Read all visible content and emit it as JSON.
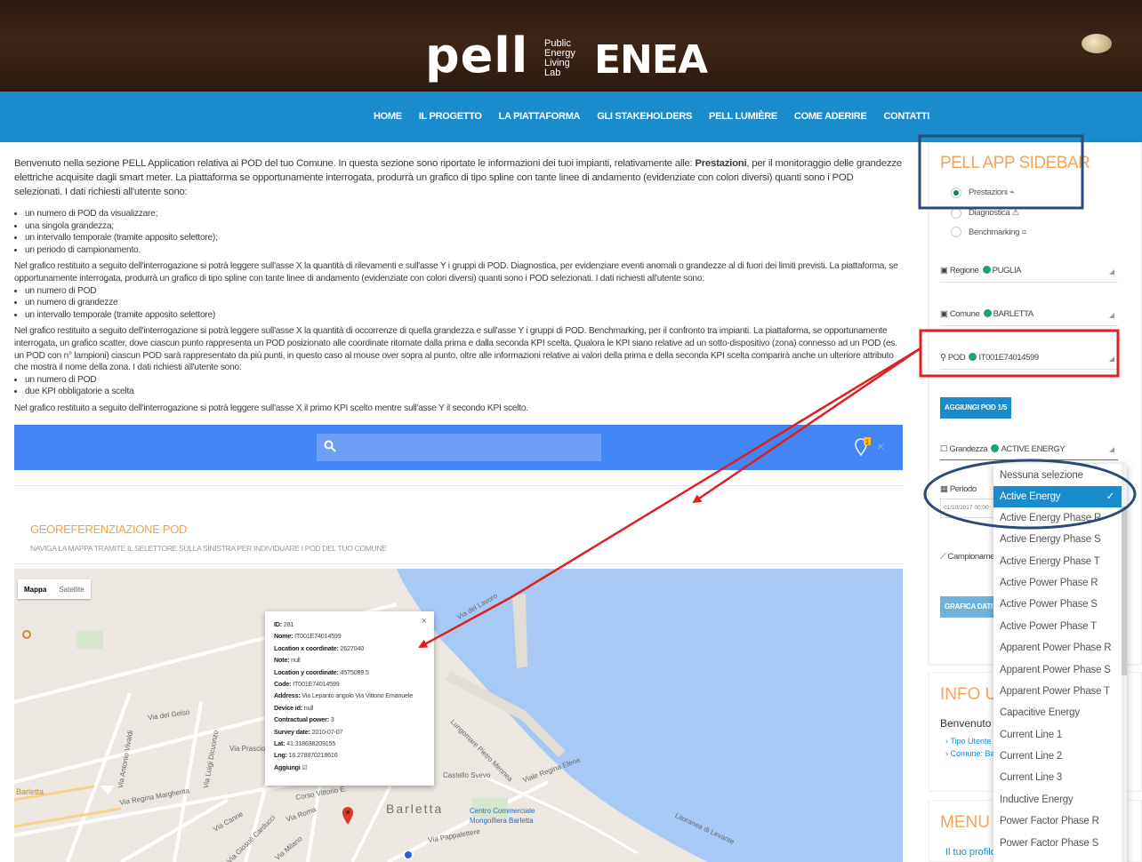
{
  "header": {
    "logo_pell": "pell",
    "logo_sub": [
      "Public",
      "Energy",
      "Living",
      "Lab"
    ],
    "logo_enea": "ENEA"
  },
  "nav": {
    "items": [
      "HOME",
      "IL PROGETTO",
      "LA PIATTAFORMA",
      "GLI STAKEHOLDERS",
      "PELL LUMIÈRE",
      "COME ADERIRE",
      "CONTATTI"
    ]
  },
  "content": {
    "intro_a": "Benvenuto nella sezione PELL Application relativa ai POD del tuo Comune. In questa sezione sono riportate le informazioni dei tuoi impianti, relativamente alle: ",
    "intro_bold": "Prestazioni",
    "intro_b": ", per il monitoraggio delle grandezze elettriche acquisite dagli smart meter. La piattaforma se opportunamente interrogata, produrrà un grafico di tipo spline con tante linee di andamento (evidenziate con colori diversi) quanti sono i POD selezionati. I dati richiesti all'utente sono:",
    "list1": [
      "un numero di POD da visualizzare;",
      "una singola grandezza;",
      "un intervallo temporale (tramite apposito selettore);",
      "un periodo di campionamento."
    ],
    "para2": "Nel grafico restituito a seguito dell'interrogazione si potrà leggere sull'asse X la quantità di rilevamenti e sull'asse Y i gruppi di POD. Diagnostica, per evidenziare eventi anomali o grandezze al di fuori dei limiti previsti. La piattaforma, se opportunamente interrogata, produrrà un grafico di tipo spline con tante linee di andamento (evidenziate con colori diversi) quanti sono i POD selezionati. I dati richiesti all'utente sono:",
    "list2": [
      "un numero di POD",
      "un numero di grandezze",
      "un intervallo temporale (tramite apposito selettore)"
    ],
    "para3": "Nel grafico restituito a seguito dell'interrogazione si potrà leggere sull'asse X la quantità di occorrenze di quella grandezza e sull'asse Y i gruppi di POD. Benchmarking, per il confronto tra impianti. La piattaforma, se opportunamente interrogata, un grafico scatter, dove ciascun punto rappresenta un POD posizionato alle coordinate ritornate dalla prima e dalla seconda KPI scelta. Qualora le KPI siano relative ad un sotto-dispositivo (zona) connesso ad un POD (es. un POD con n° lampioni) ciascun POD sarà rappresentato da più punti, in questo caso al mouse over sopra al punto, oltre alle informazioni relative ai valori della prima e della seconda KPI scelta comparirà anche un ulteriore attributo che mostra il nome della zona. I dati richiesti all'utente sono:",
    "list3": [
      "un numero di POD",
      "due KPI obbligatorie a scelta"
    ],
    "para4": "Nel grafico restituito a seguito dell'interrogazione si potrà leggere sull'asse X il primo KPI scelto mentre sull'asse Y il secondo KPI scelto."
  },
  "search": {
    "notify_count": "1",
    "close": "×"
  },
  "geo": {
    "title": "GEOREFERENZIAZIONE POD",
    "subtitle": "NAVIGA LA MAPPA TRAMITE IL SELETTORE SULLA SINISTRA PER INDIVIDUARE I POD DEL TUO COMUNE"
  },
  "map": {
    "toggle_map": "Mappa",
    "toggle_sat": "Satellite",
    "city": "Barletta",
    "labels": [
      "Via del Gelso",
      "Via Prascio",
      "Via Luigi Dicuonzo",
      "Via Antonio Vivaldi",
      "Via Regina Margherita",
      "Via Roma",
      "Via Canne",
      "Via Giosuè Carducci",
      "Via Pappalettere",
      "Litoranea di Levante",
      "Centro Commerciale",
      "Mongolfiera Barletta",
      "Castello Svevo",
      "Viale Regina Elena",
      "Lungomare Pietro Mennea",
      "Barletta",
      "Via del Lavoro",
      "Corso Vittorio E.",
      "Via Milano"
    ],
    "popup": {
      "close": "×",
      "rows": [
        {
          "k": "ID:",
          "v": " 281"
        },
        {
          "k": "Nome:",
          "v": " IT001E74014599"
        },
        {
          "k": "Location x coordinate:",
          "v": " 2627040"
        },
        {
          "k": "Note:",
          "v": " null"
        },
        {
          "k": "Location y coordinate:",
          "v": " 4575089.5"
        },
        {
          "k": "Code:",
          "v": " IT001E74014599"
        },
        {
          "k": "Address:",
          "v": " Via Lepanto angolo Via Vittorio Emanuele"
        },
        {
          "k": "Device id:",
          "v": " null"
        },
        {
          "k": "Contractual power:",
          "v": " 3"
        },
        {
          "k": "Survey date:",
          "v": " 2010-07-07"
        },
        {
          "k": "Lat:",
          "v": " 41.318638209155"
        },
        {
          "k": "Lng:",
          "v": " 16.278870218616"
        },
        {
          "k": "Aggiungi",
          "v": " ☑"
        }
      ]
    }
  },
  "sidebar": {
    "title": "PELL APP SIDEBAR",
    "radios": [
      {
        "label": "Prestazioni ⌁",
        "selected": true
      },
      {
        "label": "Diagnostica ⚠",
        "selected": false
      },
      {
        "label": "Benchmarking ⌗",
        "selected": false
      }
    ],
    "regione_label": "Regione",
    "regione_value": "PUGLIA",
    "comune_label": "Comune",
    "comune_value": "BARLETTA",
    "pod_label": "POD",
    "pod_value": "IT001E74014599",
    "add_pod_button": "AGGIUNGI POD 1/5",
    "grandezza_label": "Grandezza",
    "grandezza_value": "ACTIVE ENERGY",
    "periodo_label": "Periodo",
    "periodo_value": "01/10/2017 00:00",
    "campionamento_label": "Campionamen",
    "grafica_button": "GRAFICA DATI",
    "info_title": "INFO UT",
    "info_welcome": "Benvenuto !",
    "info_links": [
      "Tipo Utente",
      "Comune: Ba"
    ],
    "menu_title": "MENU U",
    "menu_link": "Il tuo profilo"
  },
  "dropdown": {
    "items": [
      "Nessuna selezione",
      "Active Energy",
      "Active Energy Phase R",
      "Active Energy Phase S",
      "Active Energy Phase T",
      "Active Power Phase R",
      "Active Power Phase S",
      "Active Power Phase T",
      "Apparent Power Phase R",
      "Apparent Power Phase S",
      "Apparent Power Phase T",
      "Capacitive Energy",
      "Current Line 1",
      "Current Line 2",
      "Current Line 3",
      "Inductive Energy",
      "Power Factor Phase R",
      "Power Factor Phase S"
    ],
    "selected_index": 1,
    "check": "✓"
  },
  "colors": {
    "accent": "#1a8ccd",
    "orange": "#f5a45c",
    "annot_red": "#e02020",
    "annot_navy": "#2b4a78"
  }
}
